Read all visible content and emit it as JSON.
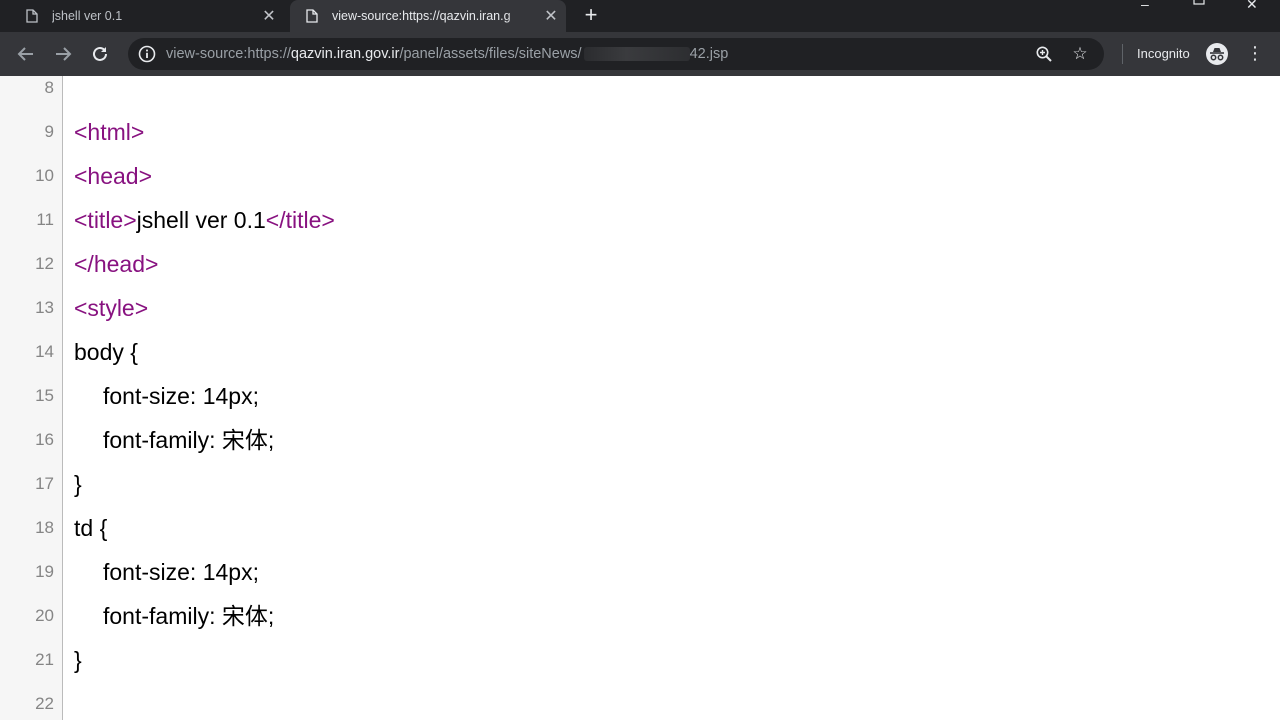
{
  "browser": {
    "tabs": [
      {
        "title": "jshell ver 0.1",
        "active": false
      },
      {
        "title": "view-source:https://qazvin.iran.g",
        "active": true
      }
    ],
    "url": {
      "prefix": "view-source:https://",
      "host": "qazvin.iran.gov.ir",
      "path": "/panel/assets/files/siteNews/",
      "suffix": "42.jsp"
    },
    "incognito_label": "Incognito",
    "icons": {
      "tab": "page-icon",
      "close": "close-icon",
      "new_tab": "plus-icon",
      "back": "back-arrow-icon",
      "forward": "forward-arrow-icon",
      "reload": "reload-icon",
      "info": "info-icon",
      "zoom": "zoom-icon",
      "bookmark": "star-icon",
      "incognito": "incognito-icon",
      "menu": "menu-dots-icon"
    }
  },
  "source": {
    "lines": [
      {
        "num": "8",
        "open": "",
        "text": "",
        "close": "",
        "indent": false
      },
      {
        "num": "9",
        "open": "<html>",
        "text": "",
        "close": "",
        "indent": false
      },
      {
        "num": "10",
        "open": "<head>",
        "text": "",
        "close": "",
        "indent": false
      },
      {
        "num": "11",
        "open": "<title>",
        "text": "jshell ver 0.1",
        "close": "</title>",
        "indent": false
      },
      {
        "num": "12",
        "open": "</head>",
        "text": "",
        "close": "",
        "indent": false
      },
      {
        "num": "13",
        "open": "<style>",
        "text": "",
        "close": "",
        "indent": false
      },
      {
        "num": "14",
        "open": "",
        "text": "body {",
        "close": "",
        "indent": false
      },
      {
        "num": "15",
        "open": "",
        "text": "font-size: 14px;",
        "close": "",
        "indent": true
      },
      {
        "num": "16",
        "open": "",
        "text": "font-family: 宋体;",
        "close": "",
        "indent": true
      },
      {
        "num": "17",
        "open": "",
        "text": "}",
        "close": "",
        "indent": false
      },
      {
        "num": "18",
        "open": "",
        "text": "td {",
        "close": "",
        "indent": false
      },
      {
        "num": "19",
        "open": "",
        "text": "font-size: 14px;",
        "close": "",
        "indent": true
      },
      {
        "num": "20",
        "open": "",
        "text": "font-family: 宋体;",
        "close": "",
        "indent": true
      },
      {
        "num": "21",
        "open": "",
        "text": "}",
        "close": "",
        "indent": false
      },
      {
        "num": "22",
        "open": "",
        "text": "",
        "close": "",
        "indent": false
      }
    ]
  },
  "colors": {
    "tag": "#881280",
    "chrome_dark": "#202124",
    "toolbar": "#35363a",
    "gutter_text": "#858585"
  }
}
